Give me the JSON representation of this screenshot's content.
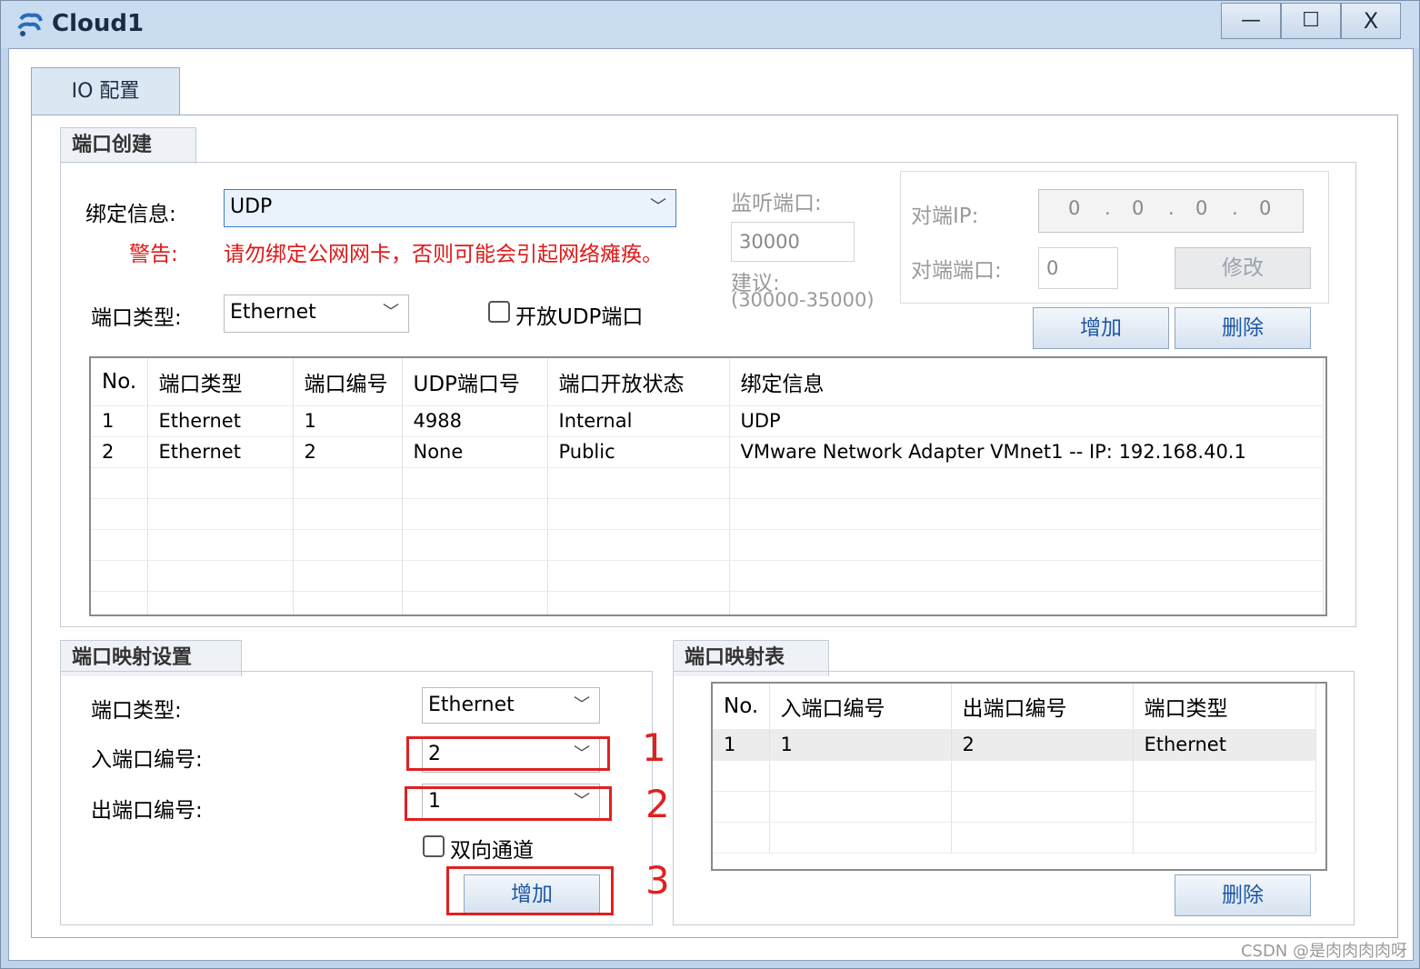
{
  "window": {
    "title": "Cloud1",
    "minimize": "—",
    "maximize": "☐",
    "close": "X"
  },
  "tabs": [
    {
      "label": "IO 配置"
    }
  ],
  "port_create": {
    "group_title": "端口创建",
    "bind_label": "绑定信息:",
    "bind_value": "UDP",
    "warn_label": "警告:",
    "warn_text": "请勿绑定公网网卡，否则可能会引起网络瘫痪。",
    "port_type_label": "端口类型:",
    "port_type_value": "Ethernet",
    "open_udp_label": "开放UDP端口",
    "listen_label": "监听端口:",
    "listen_value": "30000",
    "suggest_label": "建议:",
    "suggest_range": "(30000-35000)",
    "peer_ip_label": "对端IP:",
    "peer_ip": [
      "0",
      "0",
      "0",
      "0"
    ],
    "peer_port_label": "对端端口:",
    "peer_port_value": "0",
    "modify_button": "修改",
    "add_button": "增加",
    "delete_button": "删除",
    "table": {
      "headers": [
        "No.",
        "端口类型",
        "端口编号",
        "UDP端口号",
        "端口开放状态",
        "绑定信息"
      ],
      "rows": [
        [
          "1",
          "Ethernet",
          "1",
          "4988",
          "Internal",
          "UDP"
        ],
        [
          "2",
          "Ethernet",
          "2",
          "None",
          "Public",
          "VMware Network Adapter VMnet1 -- IP: 192.168.40.1"
        ]
      ]
    }
  },
  "port_map_settings": {
    "group_title": "端口映射设置",
    "port_type_label": "端口类型:",
    "port_type_value": "Ethernet",
    "in_port_label": "入端口编号:",
    "in_port_value": "2",
    "out_port_label": "出端口编号:",
    "out_port_value": "1",
    "bidirectional_label": "双向通道",
    "add_button": "增加"
  },
  "port_map_table": {
    "group_title": "端口映射表",
    "headers": [
      "No.",
      "入端口编号",
      "出端口编号",
      "端口类型"
    ],
    "rows": [
      [
        "1",
        "1",
        "2",
        "Ethernet"
      ]
    ],
    "delete_button": "删除"
  },
  "annotations": [
    "1",
    "2",
    "3"
  ],
  "watermark": "CSDN @是肉肉肉肉呀"
}
